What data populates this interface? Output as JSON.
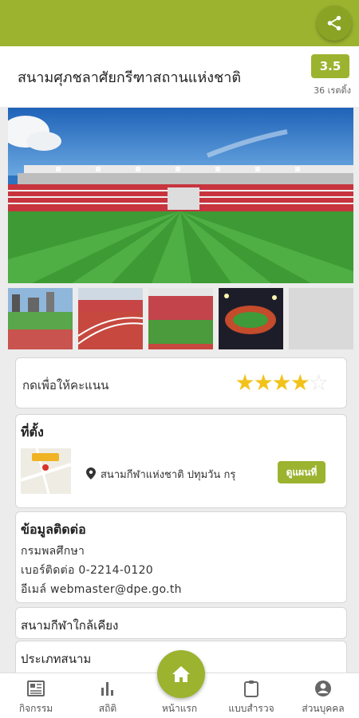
{
  "header": {
    "share_icon": "share-icon",
    "accent": "#9bb32f"
  },
  "venue": {
    "title": "สนามศุภชลาศัยกรีฑาสถานแห่งชาติ",
    "rating": "3.5",
    "votes": "36 เรตติ้ง"
  },
  "gallery": {
    "thumbnail_count": 5
  },
  "rate": {
    "label": "กดเพื่อให้คะแนน",
    "stars_filled": 4,
    "stars_total": 5
  },
  "location": {
    "heading": "ที่ตั้ง",
    "address": "สนามกีฬาแห่งชาติ ปทุมวัน กรุ",
    "map_button": "ดูแผนที่"
  },
  "contact": {
    "heading": "ข้อมูลติดต่อ",
    "org": "กรมพลศึกษา",
    "phone": "เบอร์ติดต่อ 0-2214-0120",
    "email": "อีเมล์ webmaster@dpe.go.th"
  },
  "sections": {
    "nearby": "สนามกีฬาใกล้เคียง",
    "field_type": "ประเภทสนาม"
  },
  "nav": {
    "activities": "กิจกรรม",
    "stats": "สถิติ",
    "home": "หน้าแรก",
    "survey": "แบบสำรวจ",
    "profile": "ส่วนบุคคล"
  }
}
